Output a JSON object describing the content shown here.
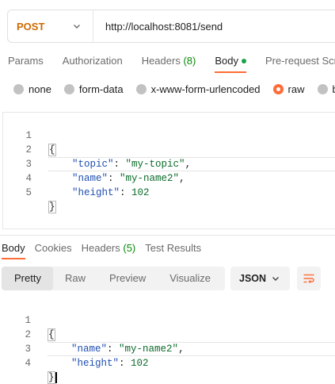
{
  "request": {
    "method": "POST",
    "url": "http://localhost:8081/send",
    "tabs": [
      {
        "label": "Params"
      },
      {
        "label": "Authorization"
      },
      {
        "label": "Headers",
        "count": "(8)"
      },
      {
        "label": "Body"
      },
      {
        "label": "Pre-request Scr"
      }
    ],
    "body_types": [
      "none",
      "form-data",
      "x-www-form-urlencoded",
      "raw",
      "b"
    ],
    "selected_body_type": "raw",
    "line_numbers": [
      "1",
      "2",
      "3",
      "4",
      "5"
    ],
    "body": {
      "open": "{",
      "close": "}",
      "k1": "\"topic\"",
      "v1": "\"my-topic\"",
      "k2": "\"name\"",
      "v2": "\"my-name2\"",
      "k3": "\"height\"",
      "v3": "102"
    }
  },
  "response": {
    "tabs": [
      {
        "label": "Body"
      },
      {
        "label": "Cookies"
      },
      {
        "label": "Headers",
        "count": "(5)"
      },
      {
        "label": "Test Results"
      }
    ],
    "views": [
      "Pretty",
      "Raw",
      "Preview",
      "Visualize"
    ],
    "format": "JSON",
    "line_numbers": [
      "1",
      "2",
      "3",
      "4"
    ],
    "body": {
      "open": "{",
      "close": "}",
      "k1": "\"name\"",
      "v1": "\"my-name2\"",
      "k2": "\"height\"",
      "v2": "102"
    }
  },
  "colors": {
    "accent": "#ff6c37",
    "method": "#cf6a00",
    "count": "#0a8a0a"
  },
  "icons": [
    "chevron-down-icon",
    "wrap-lines-icon"
  ]
}
